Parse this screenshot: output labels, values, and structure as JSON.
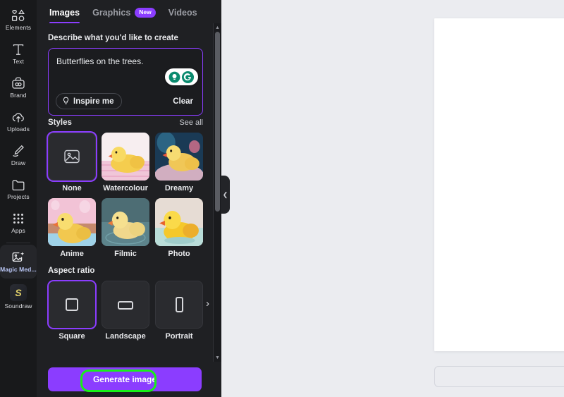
{
  "rail": {
    "items": [
      {
        "label": "Elements",
        "icon": "shapes-icon",
        "selected": false
      },
      {
        "label": "Text",
        "icon": "text-icon",
        "selected": false
      },
      {
        "label": "Brand",
        "icon": "brand-icon",
        "selected": false
      },
      {
        "label": "Uploads",
        "icon": "cloud-upload-icon",
        "selected": false
      },
      {
        "label": "Draw",
        "icon": "pen-icon",
        "selected": false
      },
      {
        "label": "Projects",
        "icon": "folder-icon",
        "selected": false
      },
      {
        "label": "Apps",
        "icon": "grid-dots-icon",
        "selected": false
      }
    ],
    "magic_media": {
      "label": "Magic Med...",
      "icon": "magic-media-icon",
      "selected": true
    },
    "soundraw": {
      "label": "Soundraw",
      "icon": "soundraw-logo-icon",
      "glyph": "S",
      "selected": false
    }
  },
  "panel": {
    "tabs": [
      {
        "label": "Images",
        "active": true,
        "badge": ""
      },
      {
        "label": "Graphics",
        "active": false,
        "badge": "New"
      },
      {
        "label": "Videos",
        "active": false,
        "badge": ""
      }
    ],
    "prompt": {
      "heading": "Describe what you'd like to create",
      "value": "Butterflies on the trees.",
      "placeholder": "Describe what you'd like to create",
      "inspire_label": "Inspire me",
      "clear_label": "Clear",
      "assistant_icons": [
        "lightbulb-icon",
        "grammarly-g-icon"
      ]
    },
    "styles": {
      "title": "Styles",
      "see_all": "See all",
      "items": [
        {
          "label": "None",
          "selected": true
        },
        {
          "label": "Watercolour",
          "selected": false
        },
        {
          "label": "Dreamy",
          "selected": false
        },
        {
          "label": "Anime",
          "selected": false
        },
        {
          "label": "Filmic",
          "selected": false
        },
        {
          "label": "Photo",
          "selected": false
        }
      ]
    },
    "aspect_ratio": {
      "title": "Aspect ratio",
      "items": [
        {
          "label": "Square",
          "selected": true,
          "shape": "square"
        },
        {
          "label": "Landscape",
          "selected": false,
          "shape": "landscape"
        },
        {
          "label": "Portrait",
          "selected": false,
          "shape": "portrait"
        }
      ],
      "next_icon": "chevron-right-icon"
    },
    "generate_label": "Generate image",
    "collapse_icon": "chevron-left-icon",
    "scrollbar": {
      "up_icon": "caret-up-icon",
      "down_icon": "caret-down-icon"
    }
  },
  "colors": {
    "accent_purple": "#8b3dff",
    "highlight_green": "#18f018",
    "rail_bg": "#18191b",
    "panel_bg": "#1f2023",
    "canvas_bg": "#ebecf0"
  }
}
